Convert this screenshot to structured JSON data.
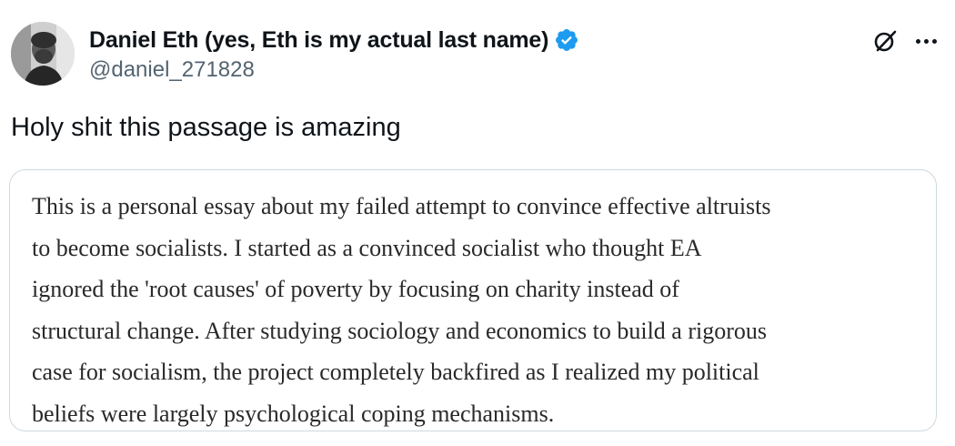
{
  "author": {
    "display_name": "Daniel Eth (yes, Eth is my actual last name)",
    "handle": "@daniel_271828",
    "verified": true,
    "avatar": "person-photo-avatar"
  },
  "actions": {
    "grok_icon": "grok-icon",
    "more_icon": "more-dots-icon"
  },
  "tweet": {
    "text": "Holy shit this passage is amazing"
  },
  "quoted_passage": {
    "text": "This is a personal essay about my failed attempt to convince effective altruists\nto become socialists. I started as a convinced socialist who thought EA\nignored the 'root causes' of poverty by focusing on charity instead of\nstructural change. After studying sociology and economics to build a rigorous\ncase for socialism, the project completely backfired as I realized my political\nbeliefs were largely psychological coping mechanisms."
  },
  "colors": {
    "text_primary": "#0f1419",
    "text_secondary": "#536471",
    "verified_blue": "#1d9bf0",
    "card_border": "#cfd9de",
    "quote_text": "#292929"
  }
}
